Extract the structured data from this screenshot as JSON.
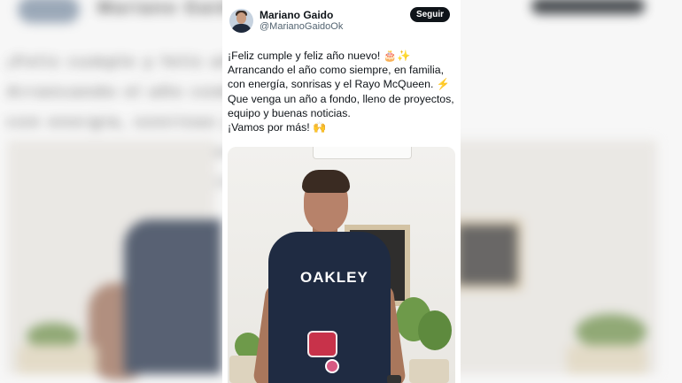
{
  "author": {
    "display_name": "Mariano Gaido",
    "handle": "@MarianoGaidoOk"
  },
  "follow_button": {
    "label": "Seguir"
  },
  "tweet": {
    "lines": [
      "¡Feliz cumple y feliz año nuevo! 🎂✨",
      "Arrancando el año como siempre, en familia,",
      "con energía, sonrisas y el Rayo McQueen. ⚡",
      "Que venga un año a fondo, lleno de proyectos,",
      "equipo y buenas noticias.",
      "¡Vamos por más! 🙌"
    ]
  },
  "photo": {
    "shirt_brand_text": "OAKLEY"
  },
  "colors": {
    "follow_bg": "#0f1419",
    "text_primary": "#0f1419",
    "text_secondary": "#536471",
    "shirt": "#1f2b42"
  }
}
